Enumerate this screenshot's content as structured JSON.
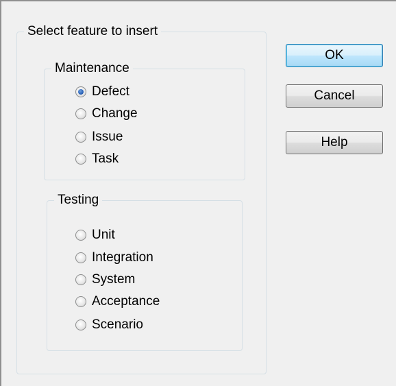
{
  "outer_group": {
    "legend": "Select feature to insert"
  },
  "maintenance": {
    "legend": "Maintenance",
    "options": [
      {
        "label": "Defect",
        "checked": true
      },
      {
        "label": "Change",
        "checked": false
      },
      {
        "label": "Issue",
        "checked": false
      },
      {
        "label": "Task",
        "checked": false
      }
    ]
  },
  "testing": {
    "legend": "Testing",
    "options": [
      {
        "label": "Unit",
        "checked": false
      },
      {
        "label": "Integration",
        "checked": false
      },
      {
        "label": "System",
        "checked": false
      },
      {
        "label": "Acceptance",
        "checked": false
      },
      {
        "label": "Scenario",
        "checked": false
      }
    ]
  },
  "buttons": {
    "ok": "OK",
    "cancel": "Cancel",
    "help": "Help"
  },
  "colors": {
    "default_button_border": "#3c7fb1",
    "radio_checked": "#2a62b8",
    "groupbox_border": "#d5dfe5"
  }
}
